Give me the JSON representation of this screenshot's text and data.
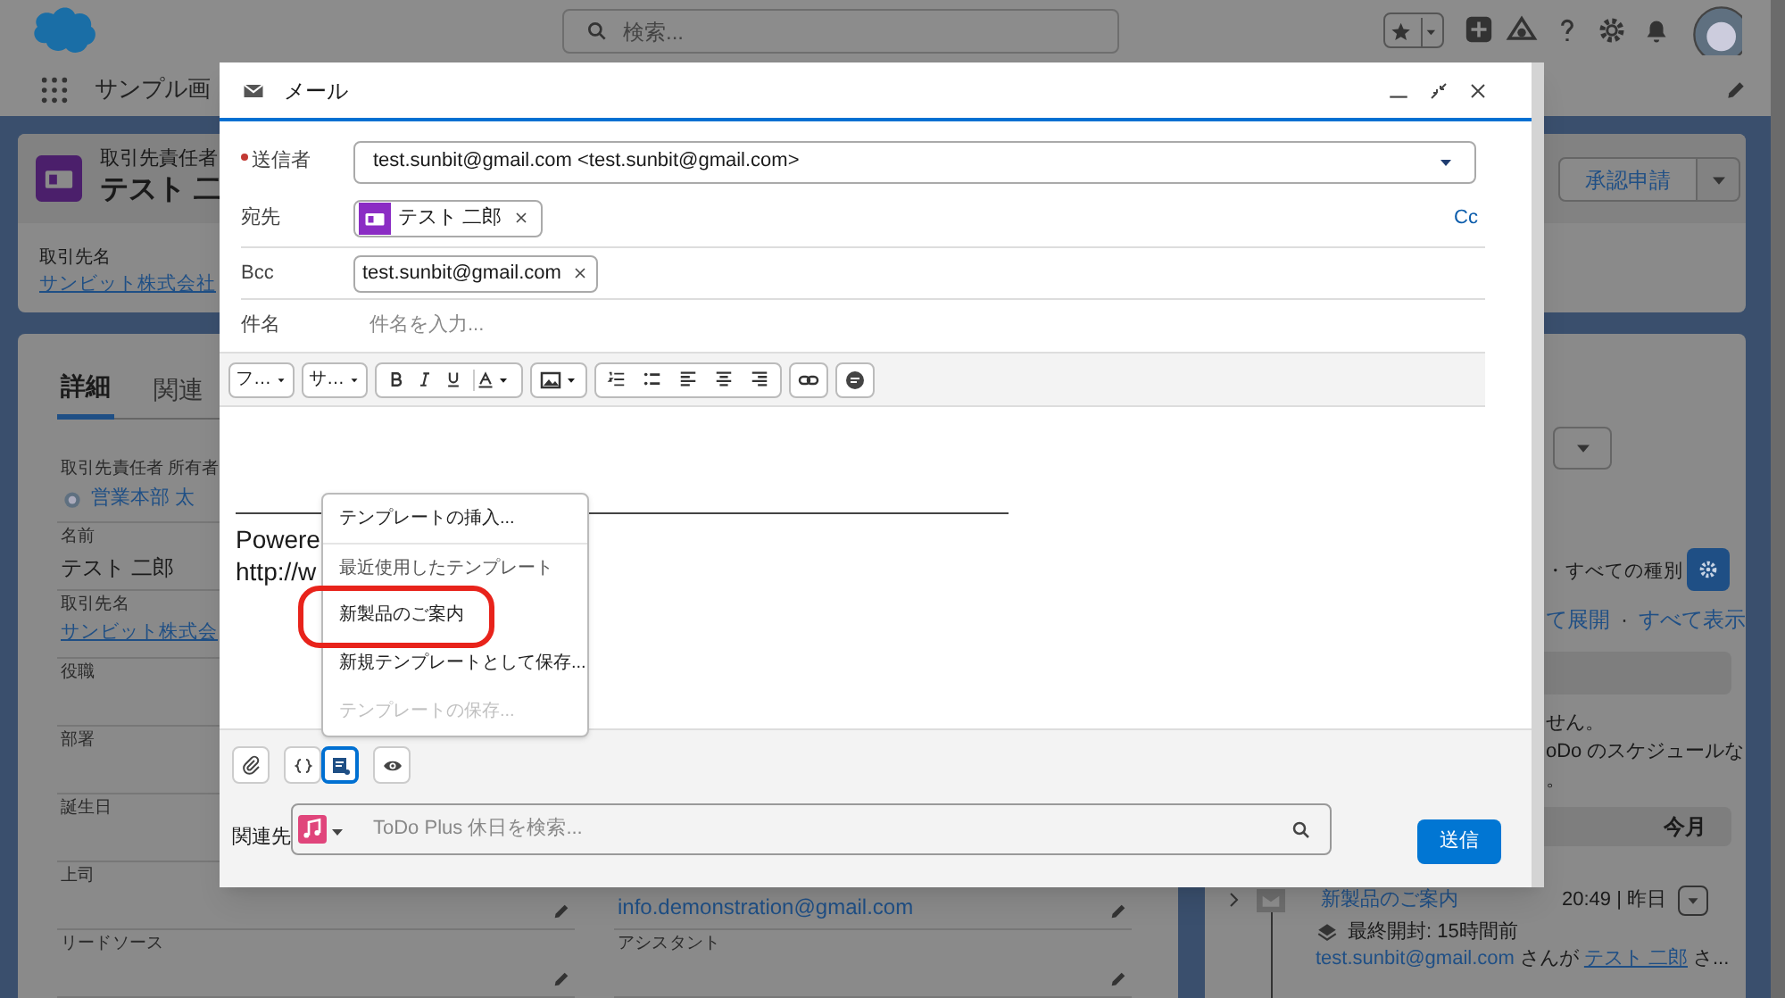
{
  "header": {
    "search_placeholder": "検索..."
  },
  "nav": {
    "app_name": "サンプル画"
  },
  "record": {
    "type_label": "取引先責任者",
    "name": "テスト 二",
    "account_label": "取引先名",
    "account": "サンビット株式会社",
    "action_button": "承認申請"
  },
  "detail_tabs": [
    {
      "label": "詳細",
      "selected": true
    },
    {
      "label": "関連",
      "selected": false
    }
  ],
  "detail_fields": [
    {
      "label": "取引先責任者 所有者",
      "value": "営業本部 太",
      "kind": "user",
      "editable": false
    },
    {
      "label": "名前",
      "value": "テスト 二郎",
      "kind": "text",
      "editable": false
    },
    {
      "label": "取引先名",
      "value": "サンビット株式会",
      "kind": "link",
      "editable": false
    },
    {
      "label": "役職",
      "editable": false
    },
    {
      "label": "部署",
      "editable": false
    },
    {
      "label": "誕生日",
      "editable": false
    },
    {
      "label": "上司",
      "editable": true,
      "right": {
        "value": "info.demonstration@gmail.com",
        "editable": true
      }
    },
    {
      "label": "リードソース",
      "editable": true,
      "right": {
        "label": "アシスタント",
        "editable": true
      }
    }
  ],
  "activity": {
    "filter": "・すべての種別",
    "links": [
      "て展開",
      "すべて表示"
    ],
    "link_separator": "·",
    "empty_lines": [
      "せん。",
      "oDo のスケジュールな",
      "。"
    ],
    "month": "今月",
    "item": {
      "subject": "新製品のご案内",
      "time": "20:49 | 昨日",
      "opened": "最終開封: 15時間前",
      "sender": "test.sunbit@gmail.com",
      "verb": "さんが",
      "recipient": "テスト 二郎",
      "trailing": "さ..."
    }
  },
  "email": {
    "title": "メール",
    "from_label": "送信者",
    "from_required": true,
    "from": "test.sunbit@gmail.com <test.sunbit@gmail.com>",
    "to_label": "宛先",
    "to": [
      {
        "name": "テスト 二郎"
      }
    ],
    "cc_link": "Cc",
    "bcc_label": "Bcc",
    "bcc": [
      {
        "name": "test.sunbit@gmail.com"
      }
    ],
    "subject_label": "件名",
    "subject_placeholder": "件名を入力...",
    "font": "フ…",
    "size": "サ…",
    "body_lines": [
      "Powere",
      "http://w"
    ],
    "template_menu": [
      {
        "label": "テンプレートの挿入...",
        "kind": "action",
        "disabled": false,
        "highlighted": false
      },
      {
        "label": "最近使用したテンプレート",
        "kind": "header",
        "disabled": false,
        "highlighted": false
      },
      {
        "label": "新製品のご案内",
        "kind": "template",
        "disabled": false,
        "highlighted": true
      },
      {
        "label": "新規テンプレートとして保存...",
        "kind": "action",
        "disabled": false,
        "highlighted": false
      },
      {
        "label": "テンプレートの保存...",
        "kind": "action",
        "disabled": true,
        "highlighted": false
      }
    ],
    "footer_buttons": [
      {
        "kind": "attach",
        "selected": false
      },
      {
        "kind": "merge",
        "selected": false
      },
      {
        "kind": "template",
        "selected": true
      },
      {
        "kind": "preview",
        "selected": false
      }
    ],
    "related_label": "関連先",
    "related_placeholder": "ToDo Plus 休日を検索...",
    "send": "送信"
  }
}
